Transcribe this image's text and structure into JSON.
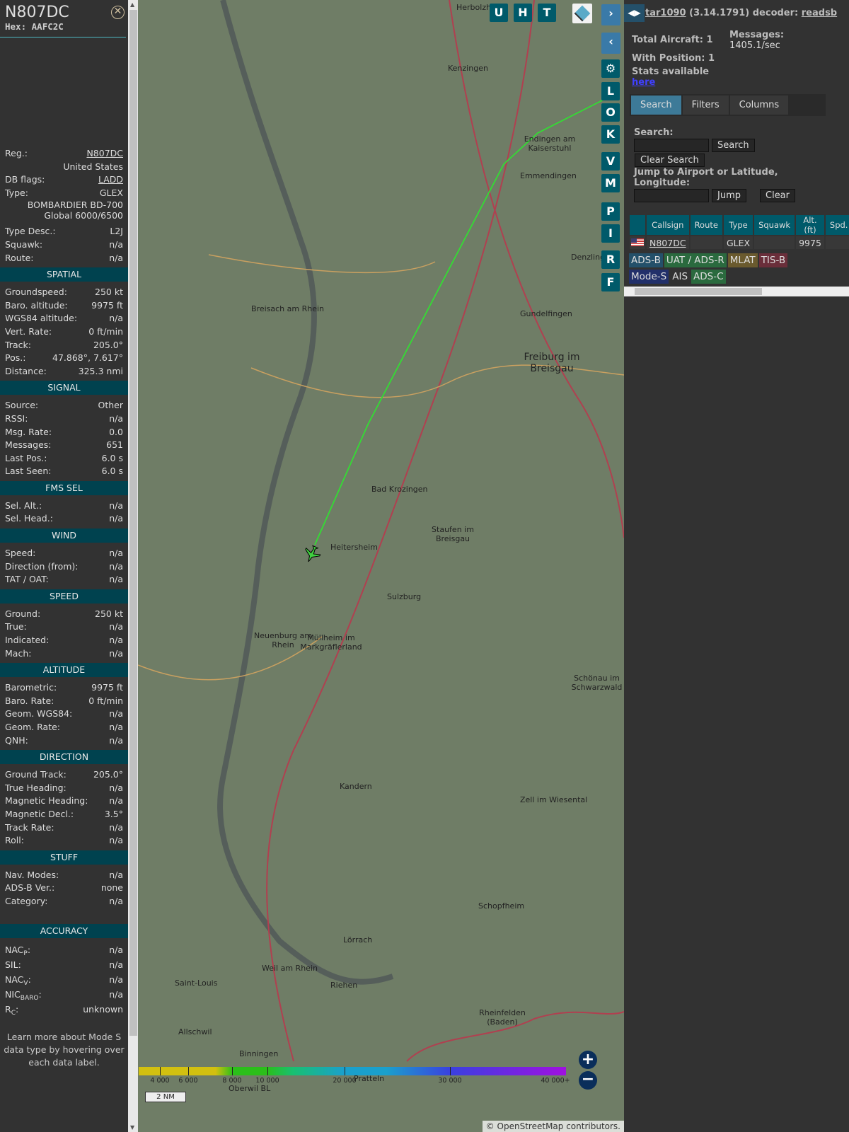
{
  "aircraft": {
    "title": "N807DC",
    "hex_label": "Hex:",
    "hex": "AAFC2C"
  },
  "info": [
    {
      "label": "Reg.:",
      "value": "N807DC",
      "link": true
    },
    {
      "label": "",
      "value": "United States"
    },
    {
      "label": "DB flags:",
      "value": "LADD",
      "link": true
    },
    {
      "label": "Type:",
      "value": "GLEX"
    }
  ],
  "type_full": [
    "BOMBARDIER BD-700",
    "Global 6000/6500"
  ],
  "info2": [
    {
      "label": "Type Desc.:",
      "value": "L2J"
    },
    {
      "label": "Squawk:",
      "value": "n/a"
    },
    {
      "label": "Route:",
      "value": "n/a"
    }
  ],
  "sections": [
    {
      "title": "SPATIAL",
      "rows": [
        [
          "Groundspeed:",
          "250 kt"
        ],
        [
          "Baro. altitude:",
          "9975 ft"
        ],
        [
          "WGS84 altitude:",
          "n/a"
        ],
        [
          "Vert. Rate:",
          "0 ft/min"
        ],
        [
          "Track:",
          "205.0°"
        ],
        [
          "Pos.:",
          "47.868°, 7.617°"
        ],
        [
          "Distance:",
          "325.3 nmi"
        ]
      ]
    },
    {
      "title": "SIGNAL",
      "rows": [
        [
          "Source:",
          "Other"
        ],
        [
          "RSSI:",
          "n/a"
        ],
        [
          "Msg. Rate:",
          "0.0"
        ],
        [
          "Messages:",
          "651"
        ],
        [
          "Last Pos.:",
          "6.0 s"
        ],
        [
          "Last Seen:",
          "6.0 s"
        ]
      ]
    },
    {
      "title": "FMS SEL",
      "rows": [
        [
          "Sel. Alt.:",
          "n/a"
        ],
        [
          "Sel. Head.:",
          "n/a"
        ]
      ]
    },
    {
      "title": "WIND",
      "rows": [
        [
          "Speed:",
          "n/a"
        ],
        [
          "Direction (from):",
          "n/a"
        ],
        [
          "TAT / OAT:",
          "n/a"
        ]
      ]
    },
    {
      "title": "SPEED",
      "rows": [
        [
          "Ground:",
          "250 kt"
        ],
        [
          "True:",
          "n/a"
        ],
        [
          "Indicated:",
          "n/a"
        ],
        [
          "Mach:",
          "n/a"
        ]
      ]
    },
    {
      "title": "ALTITUDE",
      "rows": [
        [
          "Barometric:",
          "9975 ft"
        ],
        [
          "Baro. Rate:",
          "0 ft/min"
        ],
        [
          "Geom. WGS84:",
          "n/a"
        ],
        [
          "Geom. Rate:",
          "n/a"
        ],
        [
          "QNH:",
          "n/a"
        ]
      ]
    },
    {
      "title": "DIRECTION",
      "rows": [
        [
          "Ground Track:",
          "205.0°"
        ],
        [
          "True Heading:",
          "n/a"
        ],
        [
          "Magnetic Heading:",
          "n/a"
        ],
        [
          "Magnetic Decl.:",
          "3.5°"
        ],
        [
          "Track Rate:",
          "n/a"
        ],
        [
          "Roll:",
          "n/a"
        ]
      ]
    },
    {
      "title": "STUFF",
      "rows": [
        [
          "Nav. Modes:",
          "n/a"
        ],
        [
          "ADS-B Ver.:",
          "none"
        ],
        [
          "Category:",
          "n/a"
        ]
      ]
    }
  ],
  "accuracy": {
    "title": "ACCURACY",
    "rows": [
      {
        "base": "NAC",
        "sub": "P",
        "value": "n/a"
      },
      {
        "base": "SIL",
        "sub": "",
        "value": "n/a"
      },
      {
        "base": "NAC",
        "sub": "V",
        "value": "n/a"
      },
      {
        "base": "NIC",
        "sub": "BARO",
        "value": "n/a"
      },
      {
        "base": "R",
        "sub": "C",
        "value": "unknown"
      }
    ]
  },
  "help_text": "Learn more about Mode S data type by hovering over each data label.",
  "map": {
    "top_buttons": [
      "U",
      "H",
      "T"
    ],
    "side_buttons": [
      "L",
      "O",
      "K",
      "V",
      "M",
      "P",
      "I",
      "R",
      "F"
    ],
    "towns": [
      {
        "name": "Herbolzheim",
        "big": false
      },
      {
        "name": "Kenzingen",
        "big": false
      },
      {
        "name": "Endingen am Kaiserstuhl",
        "big": false
      },
      {
        "name": "Emmendingen",
        "big": false
      },
      {
        "name": "Breisach am Rhein",
        "big": false
      },
      {
        "name": "Freiburg im Breisgau",
        "big": true
      },
      {
        "name": "Gundelfingen",
        "big": false
      },
      {
        "name": "Bad Krozingen",
        "big": false
      },
      {
        "name": "Staufen im Breisgau",
        "big": false
      },
      {
        "name": "Heitersheim",
        "big": false
      },
      {
        "name": "Sulzburg",
        "big": false
      },
      {
        "name": "Neuenburg am Rhein",
        "big": false
      },
      {
        "name": "Müllheim im Markgräflerland",
        "big": false
      },
      {
        "name": "Schönau im Schwarzwald",
        "big": false
      },
      {
        "name": "Kandern",
        "big": false
      },
      {
        "name": "Zell im Wiesental",
        "big": false
      },
      {
        "name": "Schopfheim",
        "big": false
      },
      {
        "name": "Lörrach",
        "big": false
      },
      {
        "name": "Weil am Rhein",
        "big": false
      },
      {
        "name": "Saint-Louis",
        "big": false
      },
      {
        "name": "Riehen",
        "big": false
      },
      {
        "name": "Rheinfelden (Baden)",
        "big": false
      },
      {
        "name": "Binningen",
        "big": false
      },
      {
        "name": "Allschwil",
        "big": false
      },
      {
        "name": "Pratteln",
        "big": false
      },
      {
        "name": "Oberwil BL",
        "big": false
      },
      {
        "name": "Denzlingen",
        "big": false
      }
    ],
    "legend_ticks": [
      "4 000",
      "6 000",
      "8 000",
      "10 000",
      "20 000",
      "30 000",
      "40 000+"
    ],
    "scale": "2 NM",
    "attribution": "© OpenStreetMap contributors."
  },
  "header": {
    "app": "tar1090",
    "version": "(3.14.1791)",
    "decoder_label": "decoder:",
    "decoder": "readsb"
  },
  "stats": {
    "total": "Total Aircraft: 1",
    "with_pos": "With Position: 1",
    "messages_label": "Messages:",
    "messages": "1405.1/sec",
    "stats_text": "Stats available",
    "stats_link": "here"
  },
  "tabs": [
    "Search",
    "Filters",
    "Columns"
  ],
  "search": {
    "label": "Search:",
    "search_btn": "Search",
    "clear_btn": "Clear Search",
    "jump_label": "Jump to Airport or Latitude, Longitude:",
    "jump_btn": "Jump",
    "clear2_btn": "Clear"
  },
  "table": {
    "headers": [
      "",
      "Callsign",
      "Route",
      "Type",
      "Squawk",
      "Alt. (ft)",
      "Spd."
    ],
    "rows": [
      {
        "callsign": "N807DC",
        "route": "",
        "type": "GLEX",
        "squawk": "",
        "alt": "9975",
        "spd": ""
      }
    ]
  },
  "badges": [
    {
      "label": "ADS-B",
      "color": "#24506a"
    },
    {
      "label": "UAT / ADS-R",
      "color": "#2a6a3e"
    },
    {
      "label": "MLAT",
      "color": "#6a5a2e"
    },
    {
      "label": "TIS-B",
      "color": "#6a2e3a"
    },
    {
      "label": "Mode-S",
      "color": "#22306a"
    },
    {
      "label": "AIS",
      "color": "#323232"
    },
    {
      "label": "ADS-C",
      "color": "#2a6a3e"
    }
  ]
}
